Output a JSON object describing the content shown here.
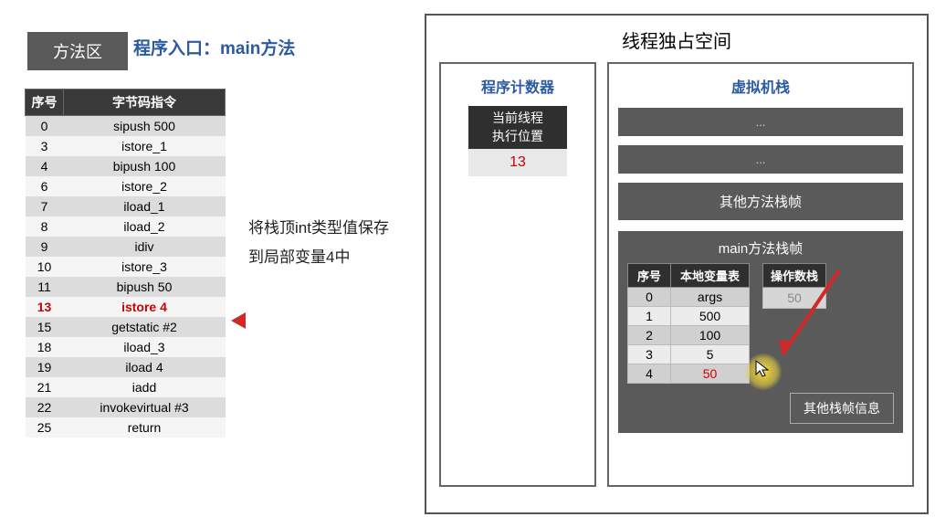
{
  "method_area_label": "方法区",
  "entry_label": "程序入口：main方法",
  "bytecode_headers": {
    "seq": "序号",
    "instr": "字节码指令"
  },
  "bytecode": [
    {
      "seq": "0",
      "instr": "sipush 500"
    },
    {
      "seq": "3",
      "instr": "istore_1"
    },
    {
      "seq": "4",
      "instr": "bipush 100"
    },
    {
      "seq": "6",
      "instr": "istore_2"
    },
    {
      "seq": "7",
      "instr": "iload_1"
    },
    {
      "seq": "8",
      "instr": "iload_2"
    },
    {
      "seq": "9",
      "instr": "idiv"
    },
    {
      "seq": "10",
      "instr": "istore_3"
    },
    {
      "seq": "11",
      "instr": "bipush 50"
    },
    {
      "seq": "13",
      "instr": "istore 4",
      "hl": true
    },
    {
      "seq": "15",
      "instr": "getstatic #2"
    },
    {
      "seq": "18",
      "instr": "iload_3"
    },
    {
      "seq": "19",
      "instr": "iload 4"
    },
    {
      "seq": "21",
      "instr": "iadd"
    },
    {
      "seq": "22",
      "instr": "invokevirtual #3"
    },
    {
      "seq": "25",
      "instr": "return"
    }
  ],
  "description": {
    "line1": "将栈顶int类型值保存",
    "line2": "到局部变量4中"
  },
  "thread_space_title": "线程独占空间",
  "pc": {
    "title": "程序计数器",
    "label1": "当前线程",
    "label2": "执行位置",
    "value": "13"
  },
  "vm_stack": {
    "title": "虚拟机栈",
    "ellipsis": "...",
    "other_frame": "其他方法栈帧",
    "main_frame_title": "main方法栈帧",
    "lv_headers": {
      "seq": "序号",
      "name": "本地变量表"
    },
    "lv": [
      {
        "seq": "0",
        "val": "args"
      },
      {
        "seq": "1",
        "val": "500"
      },
      {
        "seq": "2",
        "val": "100"
      },
      {
        "seq": "3",
        "val": "5"
      },
      {
        "seq": "4",
        "val": "50",
        "red": true
      }
    ],
    "op_header": "操作数栈",
    "op_value": "50",
    "other_info": "其他栈帧信息"
  }
}
